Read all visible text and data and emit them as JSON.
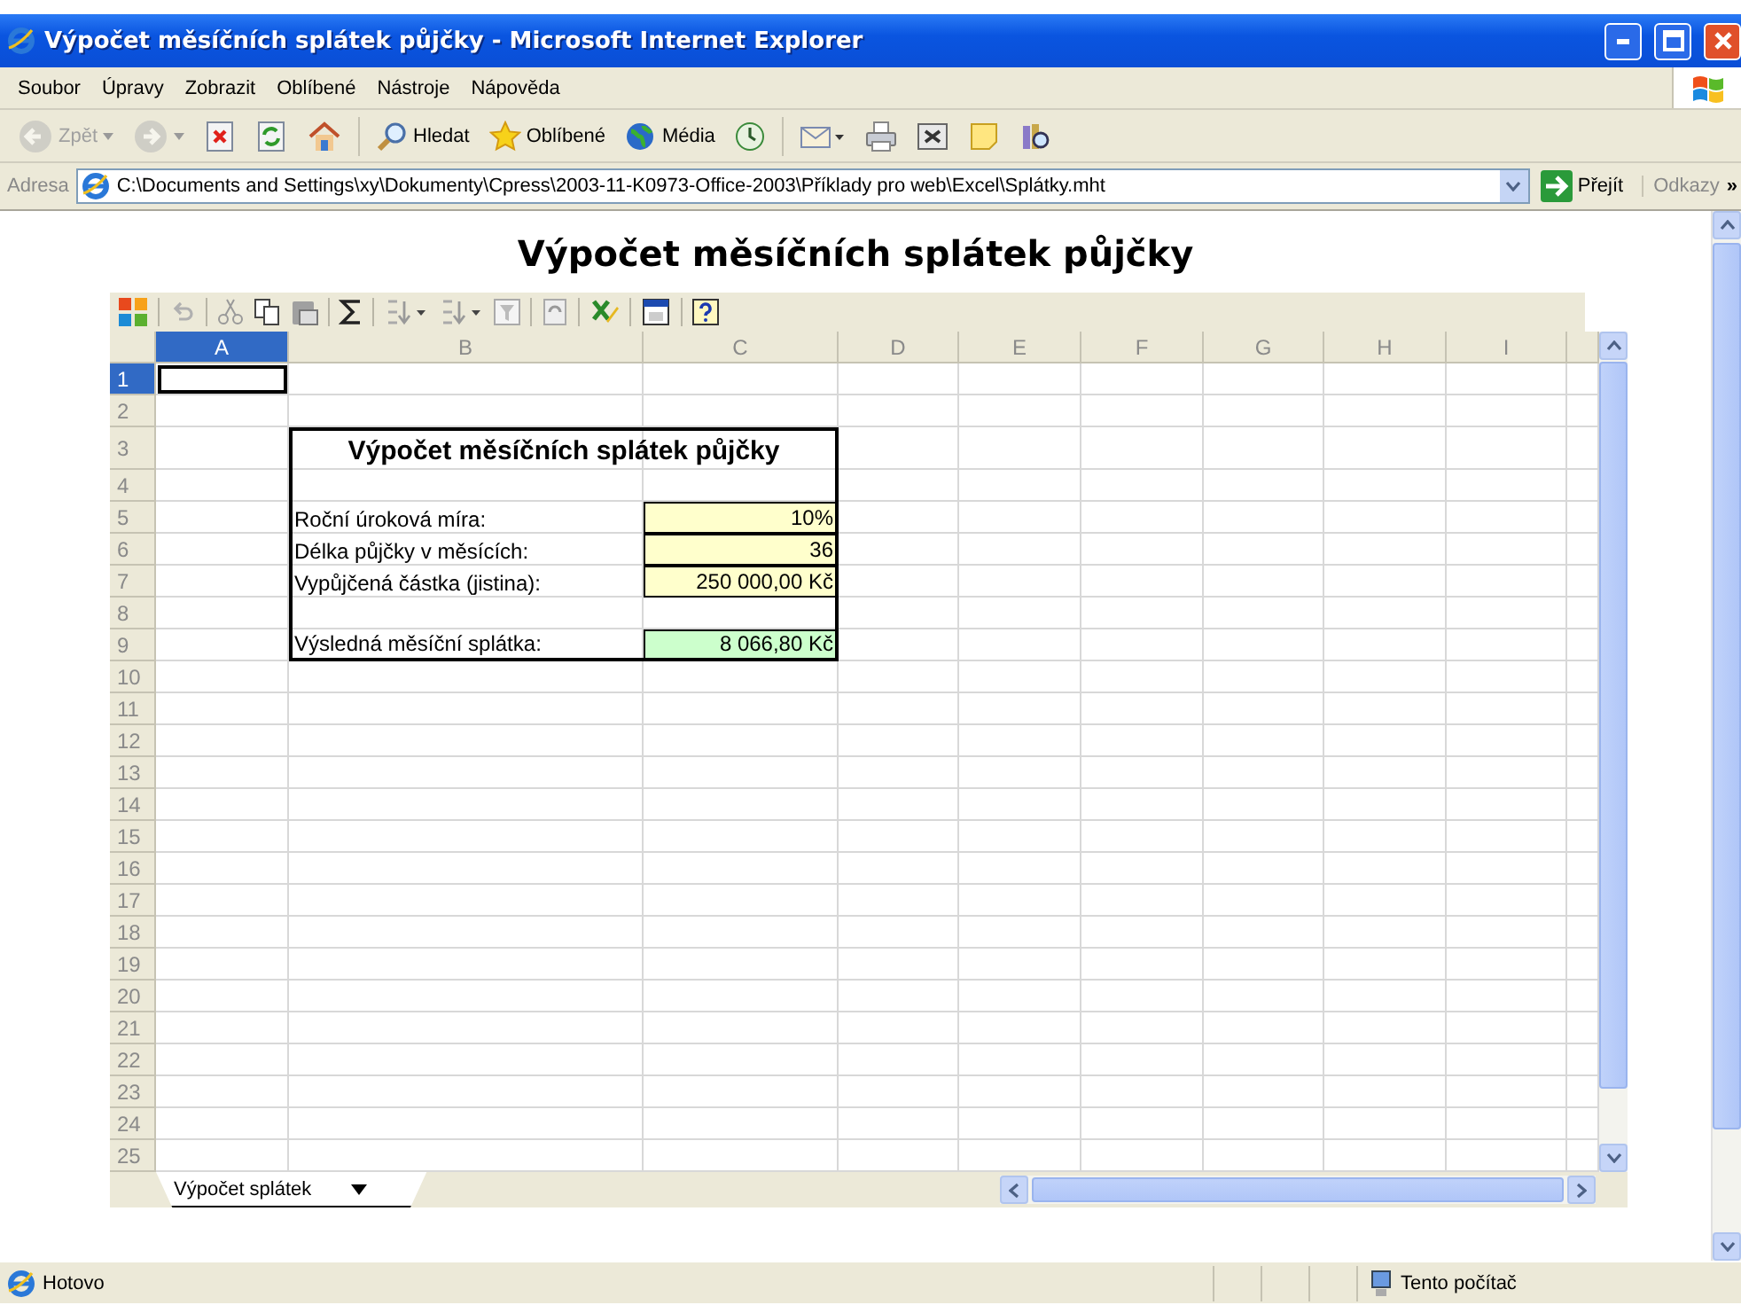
{
  "window": {
    "title": "Výpočet měsíčních splátek půjčky - Microsoft Internet Explorer"
  },
  "menu": [
    "Soubor",
    "Úpravy",
    "Zobrazit",
    "Oblíbené",
    "Nástroje",
    "Nápověda"
  ],
  "toolbar": [
    {
      "kind": "back",
      "label": "Zpět",
      "disabled": true
    },
    {
      "kind": "forward",
      "disabled": true
    },
    {
      "kind": "stop",
      "disabled": false
    },
    {
      "kind": "refresh",
      "disabled": false
    },
    {
      "kind": "home",
      "disabled": false
    },
    {
      "kind": "search",
      "label": "Hledat",
      "disabled": false
    },
    {
      "kind": "favorites",
      "label": "Oblíbené",
      "disabled": false
    },
    {
      "kind": "media",
      "label": "Média",
      "disabled": false
    },
    {
      "kind": "history",
      "disabled": false
    },
    {
      "kind": "mail",
      "disabled": false
    },
    {
      "kind": "print",
      "disabled": false
    },
    {
      "kind": "edit",
      "disabled": false
    },
    {
      "kind": "note",
      "disabled": false
    },
    {
      "kind": "research",
      "disabled": false
    }
  ],
  "address": {
    "label": "Adresa",
    "value": "C:\\Documents and Settings\\xy\\Dokumenty\\Cpress\\2003-11-K0973-Office-2003\\Příklady pro web\\Excel\\Splátky.mht",
    "go": "Přejít",
    "links": "Odkazy",
    "more": "»"
  },
  "page": {
    "heading": "Výpočet měsíčních splátek půjčky"
  },
  "spreadsheet": {
    "toolbar": [
      {
        "kind": "office"
      },
      {
        "kind": "undo"
      },
      {
        "kind": "cut"
      },
      {
        "kind": "copy"
      },
      {
        "kind": "paste"
      },
      {
        "kind": "sum"
      },
      {
        "kind": "sort-asc"
      },
      {
        "kind": "sort-desc"
      },
      {
        "kind": "filter"
      },
      {
        "kind": "refresh"
      },
      {
        "kind": "export"
      },
      {
        "kind": "commands"
      },
      {
        "kind": "help"
      }
    ],
    "columns": [
      {
        "label": "A",
        "selected": true
      },
      {
        "label": "B",
        "selected": false
      },
      {
        "label": "C",
        "selected": false
      },
      {
        "label": "D",
        "selected": false
      },
      {
        "label": "E",
        "selected": false
      },
      {
        "label": "F",
        "selected": false
      },
      {
        "label": "G",
        "selected": false
      },
      {
        "label": "H",
        "selected": false
      },
      {
        "label": "I",
        "selected": false
      }
    ],
    "rows": [
      {
        "number": "1",
        "selected": true,
        "framed": false
      },
      {
        "number": "2",
        "selected": false,
        "framed": false
      },
      {
        "number": "3",
        "selected": false,
        "framed": true,
        "title": "Výpočet měsíčních splátek půjčky"
      },
      {
        "number": "4",
        "selected": false,
        "framed": true
      },
      {
        "number": "5",
        "selected": false,
        "framed": true,
        "label": "Roční úroková míra:",
        "value": "10%",
        "kind": "input"
      },
      {
        "number": "6",
        "selected": false,
        "framed": true,
        "label": "Délka půjčky v měsících:",
        "value": "36",
        "kind": "input"
      },
      {
        "number": "7",
        "selected": false,
        "framed": true,
        "label": "Vypůjčená částka (jistina):",
        "value": "250 000,00 Kč",
        "kind": "input"
      },
      {
        "number": "8",
        "selected": false,
        "framed": true
      },
      {
        "number": "9",
        "selected": false,
        "framed": true,
        "label": "Výsledná měsíční splátka:",
        "value": "8 066,80 Kč",
        "kind": "result"
      },
      {
        "number": "10",
        "selected": false,
        "framed": false
      },
      {
        "number": "11",
        "selected": false,
        "framed": false
      },
      {
        "number": "12",
        "selected": false,
        "framed": false
      },
      {
        "number": "13",
        "selected": false,
        "framed": false
      },
      {
        "number": "14",
        "selected": false,
        "framed": false
      },
      {
        "number": "15",
        "selected": false,
        "framed": false
      },
      {
        "number": "16",
        "selected": false,
        "framed": false
      },
      {
        "number": "17",
        "selected": false,
        "framed": false
      },
      {
        "number": "18",
        "selected": false,
        "framed": false
      },
      {
        "number": "19",
        "selected": false,
        "framed": false
      },
      {
        "number": "20",
        "selected": false,
        "framed": false
      },
      {
        "number": "21",
        "selected": false,
        "framed": false
      },
      {
        "number": "22",
        "selected": false,
        "framed": false
      },
      {
        "number": "23",
        "selected": false,
        "framed": false
      },
      {
        "number": "24",
        "selected": false,
        "framed": false
      },
      {
        "number": "25",
        "selected": false,
        "framed": false
      }
    ],
    "sheet_tab": "Výpočet splátek"
  },
  "status_bar": {
    "text": "Hotovo",
    "zone": "Tento počítač"
  }
}
